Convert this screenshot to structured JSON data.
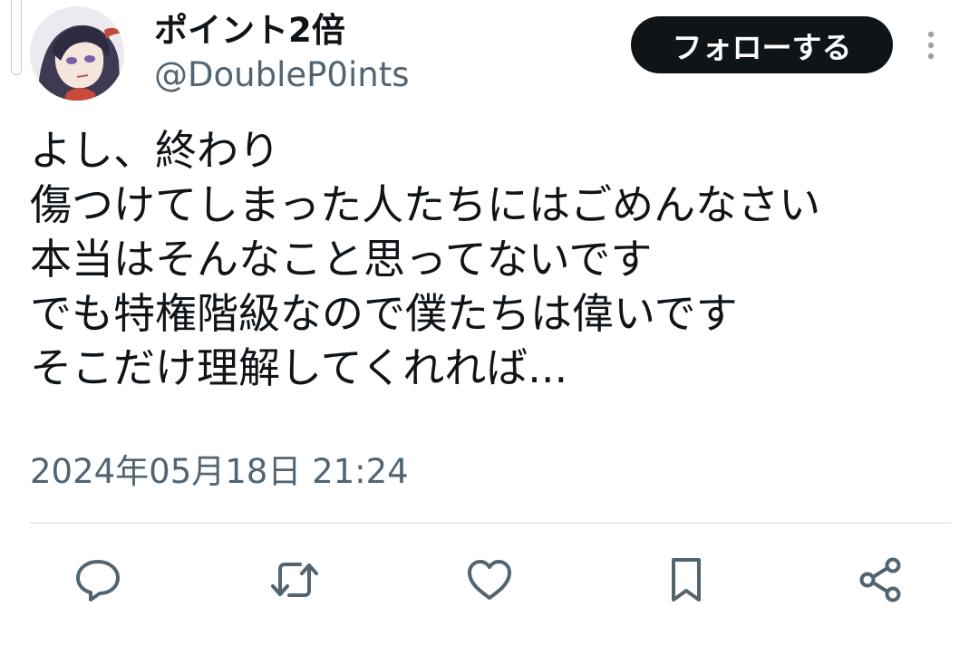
{
  "user": {
    "display_name": "ポイント2倍",
    "handle": "@DoubleP0ints"
  },
  "header": {
    "follow_label": "フォローする",
    "more_icon": "more-vertical-icon"
  },
  "tweet": {
    "lines": [
      "よし、終わり",
      "傷つけてしまった人たちにはごめんなさい",
      "本当はそんなこと思ってないです",
      "でも特権階級なので僕たちは偉いです",
      "そこだけ理解してくれれば..."
    ],
    "timestamp": "2024年05月18日 21:24"
  },
  "actions": {
    "icons": [
      "reply-icon",
      "retweet-icon",
      "like-icon",
      "bookmark-icon",
      "share-icon"
    ]
  },
  "colors": {
    "text": "#0f1419",
    "secondary": "#536471",
    "button_bg": "#0f1419",
    "button_text": "#ffffff",
    "divider": "#e6e9ec"
  }
}
